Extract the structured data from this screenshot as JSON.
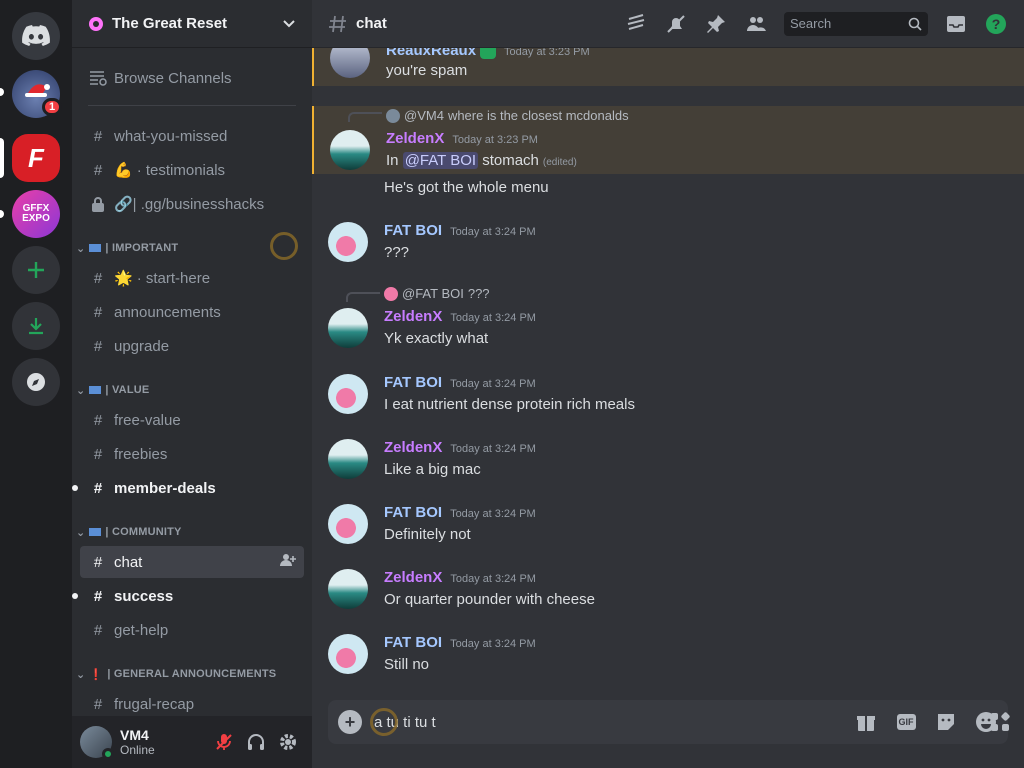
{
  "server_rail": {
    "unread_badge": "1",
    "server_b_letter": "F",
    "server_c_text": "GFFX\nEXPO"
  },
  "guild": {
    "name": "The Great Reset"
  },
  "sidebar": {
    "browse": "Browse Channels",
    "channels_top": [
      {
        "label": "what-you-missed"
      },
      {
        "label": "· testimonials"
      },
      {
        "label": "🔗| .gg/businesshacks"
      }
    ],
    "cat_important": "| IMPORTANT",
    "important": [
      {
        "label": "· start-here"
      },
      {
        "label": "announcements"
      },
      {
        "label": "upgrade"
      }
    ],
    "cat_value": "| VALUE",
    "value": [
      {
        "label": "free-value"
      },
      {
        "label": "freebies"
      },
      {
        "label": "member-deals"
      }
    ],
    "cat_community": "| COMMUNITY",
    "community": [
      {
        "label": "chat"
      },
      {
        "label": "success"
      },
      {
        "label": "get-help"
      }
    ],
    "cat_general": "| GENERAL ANNOUNCEMENTS",
    "general": [
      {
        "label": "frugal-recap"
      }
    ]
  },
  "user": {
    "name": "VM4",
    "status": "Online"
  },
  "topbar": {
    "channel": "chat",
    "search_placeholder": "Search"
  },
  "messages": [
    {
      "author": "ReauxReaux",
      "time": "Today at 3:23 PM",
      "text": "you're spam"
    },
    {
      "reply_to": "@VM4",
      "reply_text": "where is the closest mcdonalds",
      "author": "ZeldenX",
      "time": "Today at 3:23 PM",
      "text_pre": "In ",
      "mention": "@FAT BOI",
      "text_post": " stomach",
      "edited": "(edited)",
      "text2": "He's got the whole menu"
    },
    {
      "author": "FAT BOI",
      "time": "Today at 3:24 PM",
      "text": "???"
    },
    {
      "reply_to": "@FAT BOI",
      "reply_text": "???",
      "author": "ZeldenX",
      "time": "Today at 3:24 PM",
      "text": "Yk exactly what"
    },
    {
      "author": "FAT BOI",
      "time": "Today at 3:24 PM",
      "text": "I eat nutrient dense protein rich meals"
    },
    {
      "author": "ZeldenX",
      "time": "Today at 3:24 PM",
      "text": "Like a big mac"
    },
    {
      "author": "FAT BOI",
      "time": "Today at 3:24 PM",
      "text": "Definitely not"
    },
    {
      "author": "ZeldenX",
      "time": "Today at 3:24 PM",
      "text": "Or quarter pounder with cheese"
    },
    {
      "author": "FAT BOI",
      "time": "Today at 3:24 PM",
      "text": "Still no"
    }
  ],
  "composer": {
    "value": "a tu ti tu t",
    "gif_label": "GIF"
  },
  "colors": {
    "accent": "#5865f2",
    "online": "#23a55a",
    "mention_highlight": "#f0b132",
    "zelden": "#c77dff",
    "fatboi": "#a5c8ff"
  }
}
